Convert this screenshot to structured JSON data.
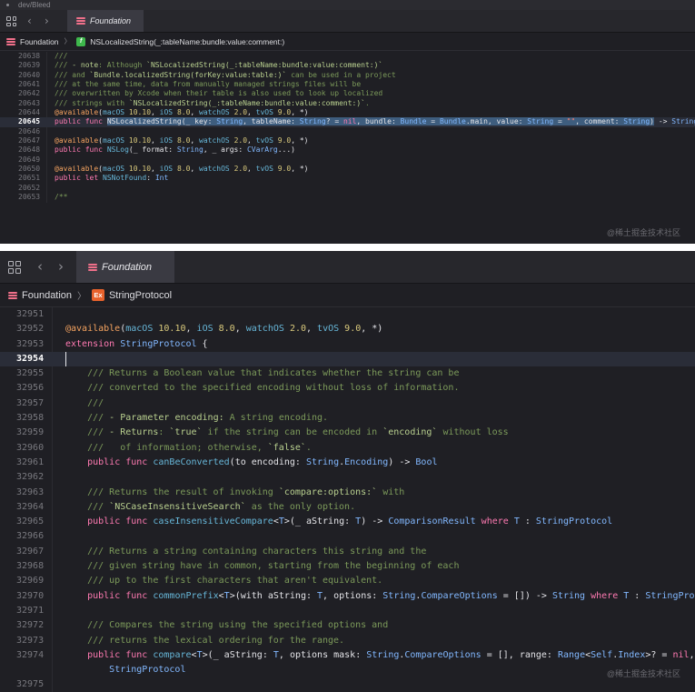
{
  "top_panel": {
    "window_title": "dev/Bleed",
    "tab_label": "Foundation",
    "breadcrumb": {
      "module": "Foundation",
      "symbol_badge": "f",
      "symbol": "NSLocalizedString(_:tableName:bundle:value:comment:)"
    },
    "lines": [
      {
        "n": "20638",
        "t": "///",
        "cls": "c"
      },
      {
        "n": "20639",
        "t": "/// - note: Although `NSLocalizedString(_:tableName:bundle:value:comment:)`",
        "cls": "c"
      },
      {
        "n": "20640",
        "t": "/// and `Bundle.localizedString(forKey:value:table:)` can be used in a project",
        "cls": "c"
      },
      {
        "n": "20641",
        "t": "/// at the same time, data from manually managed strings files will be",
        "cls": "c"
      },
      {
        "n": "20642",
        "t": "/// overwritten by Xcode when their table is also used to look up localized",
        "cls": "c"
      },
      {
        "n": "20643",
        "t": "/// strings with `NSLocalizedString(_:tableName:bundle:value:comment:)`.",
        "cls": "c"
      },
      {
        "n": "20644",
        "t": "@available(macOS 10.10, iOS 8.0, watchOS 2.0, tvOS 9.0, *)",
        "cls": "at"
      },
      {
        "n": "20645",
        "t": "public func NSLocalizedString(_ key: String, tableName: String? = nil, bundle: Bundle = Bundle.main, value: String = \"\", comment: String) -> String",
        "cls": "plain",
        "current": true
      },
      {
        "n": "20646",
        "t": "",
        "cls": "plain"
      },
      {
        "n": "20647",
        "t": "@available(macOS 10.10, iOS 8.0, watchOS 2.0, tvOS 9.0, *)",
        "cls": "at"
      },
      {
        "n": "20648",
        "t": "public func NSLog(_ format: String, _ args: CVarArg...)",
        "cls": "plain"
      },
      {
        "n": "20649",
        "t": "",
        "cls": "plain"
      },
      {
        "n": "20650",
        "t": "@available(macOS 10.10, iOS 8.0, watchOS 2.0, tvOS 9.0, *)",
        "cls": "at"
      },
      {
        "n": "20651",
        "t": "public let NSNotFound: Int",
        "cls": "plain"
      },
      {
        "n": "20652",
        "t": "",
        "cls": "plain"
      },
      {
        "n": "20653",
        "t": "/**",
        "cls": "c"
      }
    ],
    "watermark": "@稀土掘金技术社区"
  },
  "bottom_panel": {
    "tab_label": "Foundation",
    "breadcrumb": {
      "module": "Foundation",
      "symbol_badge": "Ex",
      "symbol": "StringProtocol"
    },
    "lines": [
      {
        "n": "32951",
        "t": "",
        "cls": "plain"
      },
      {
        "n": "32952",
        "t": "@available(macOS 10.10, iOS 8.0, watchOS 2.0, tvOS 9.0, *)",
        "cls": "at"
      },
      {
        "n": "32953",
        "t": "extension StringProtocol {",
        "cls": "plain"
      },
      {
        "n": "32954",
        "t": "",
        "cls": "plain",
        "current": true
      },
      {
        "n": "32955",
        "t": "    /// Returns a Boolean value that indicates whether the string can be",
        "cls": "c"
      },
      {
        "n": "32956",
        "t": "    /// converted to the specified encoding without loss of information.",
        "cls": "c"
      },
      {
        "n": "32957",
        "t": "    ///",
        "cls": "c"
      },
      {
        "n": "32958",
        "t": "    /// - Parameter encoding: A string encoding.",
        "cls": "c"
      },
      {
        "n": "32959",
        "t": "    /// - Returns: `true` if the string can be encoded in `encoding` without loss",
        "cls": "c"
      },
      {
        "n": "32960",
        "t": "    ///   of information; otherwise, `false`.",
        "cls": "c"
      },
      {
        "n": "32961",
        "t": "    public func canBeConverted(to encoding: String.Encoding) -> Bool",
        "cls": "plain"
      },
      {
        "n": "32962",
        "t": "",
        "cls": "plain"
      },
      {
        "n": "32963",
        "t": "    /// Returns the result of invoking `compare:options:` with",
        "cls": "c"
      },
      {
        "n": "32964",
        "t": "    /// `NSCaseInsensitiveSearch` as the only option.",
        "cls": "c"
      },
      {
        "n": "32965",
        "t": "    public func caseInsensitiveCompare<T>(_ aString: T) -> ComparisonResult where T : StringProtocol",
        "cls": "plain"
      },
      {
        "n": "32966",
        "t": "",
        "cls": "plain"
      },
      {
        "n": "32967",
        "t": "    /// Returns a string containing characters this string and the",
        "cls": "c"
      },
      {
        "n": "32968",
        "t": "    /// given string have in common, starting from the beginning of each",
        "cls": "c"
      },
      {
        "n": "32969",
        "t": "    /// up to the first characters that aren't equivalent.",
        "cls": "c"
      },
      {
        "n": "32970",
        "t": "    public func commonPrefix<T>(with aString: T, options: String.CompareOptions = []) -> String where T : StringProtocol",
        "cls": "plain"
      },
      {
        "n": "32971",
        "t": "",
        "cls": "plain"
      },
      {
        "n": "32972",
        "t": "    /// Compares the string using the specified options and",
        "cls": "c"
      },
      {
        "n": "32973",
        "t": "    /// returns the lexical ordering for the range.",
        "cls": "c"
      },
      {
        "n": "32974",
        "t": "    public func compare<T>(_ aString: T, options mask: String.CompareOptions = [], range: Range<Self.Index>? = nil, l",
        "cls": "plain"
      },
      {
        "n": "",
        "t": "        StringProtocol",
        "cls": "plain"
      },
      {
        "n": "32975",
        "t": "",
        "cls": "plain"
      }
    ],
    "watermark": "@稀土掘金技术社区"
  },
  "icons": {
    "grid": "grid-icon",
    "back": "chevron-left-icon",
    "forward": "chevron-right-icon",
    "module": "foundation-stack-icon"
  },
  "colors": {
    "background": "#1f1f24",
    "comment": "#7c9a5a",
    "keyword": "#ff7ab2",
    "type": "#82b8ff",
    "attribute": "#f5a360",
    "selection": "#3e5d7e"
  }
}
